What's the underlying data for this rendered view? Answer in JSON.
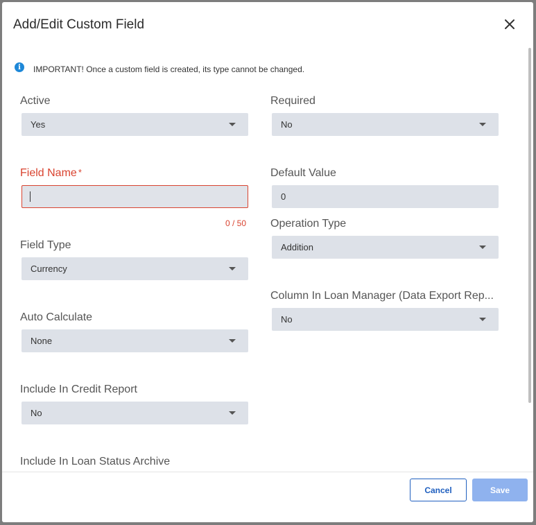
{
  "dialog": {
    "title": "Add/Edit Custom Field",
    "close_icon": "close-icon"
  },
  "notice": {
    "icon": "info-icon",
    "text": "IMPORTANT! Once a custom field is created, its type cannot be changed."
  },
  "fields": {
    "active": {
      "label": "Active",
      "value": "Yes"
    },
    "required": {
      "label": "Required",
      "value": "No"
    },
    "field_name": {
      "label": "Field Name",
      "required_mark": "*",
      "value": "",
      "counter": "0 / 50"
    },
    "default_value": {
      "label": "Default Value",
      "value": "0"
    },
    "operation_type": {
      "label": "Operation Type",
      "value": "Addition"
    },
    "field_type": {
      "label": "Field Type",
      "value": "Currency"
    },
    "column_in_loan_manager": {
      "label": "Column In Loan Manager (Data Export Rep...",
      "value": "No"
    },
    "auto_calculate": {
      "label": "Auto Calculate",
      "value": "None"
    },
    "include_in_credit_report": {
      "label": "Include In Credit Report",
      "value": "No"
    },
    "include_in_loan_status_archive": {
      "label": "Include In Loan Status Archive"
    }
  },
  "footer": {
    "cancel_label": "Cancel",
    "save_label": "Save"
  },
  "colors": {
    "error": "#d9432f",
    "primary": "#1f5fbf",
    "primary_disabled": "#8fb2ee",
    "input_bg": "#dde1e8",
    "info": "#1e88d8"
  }
}
